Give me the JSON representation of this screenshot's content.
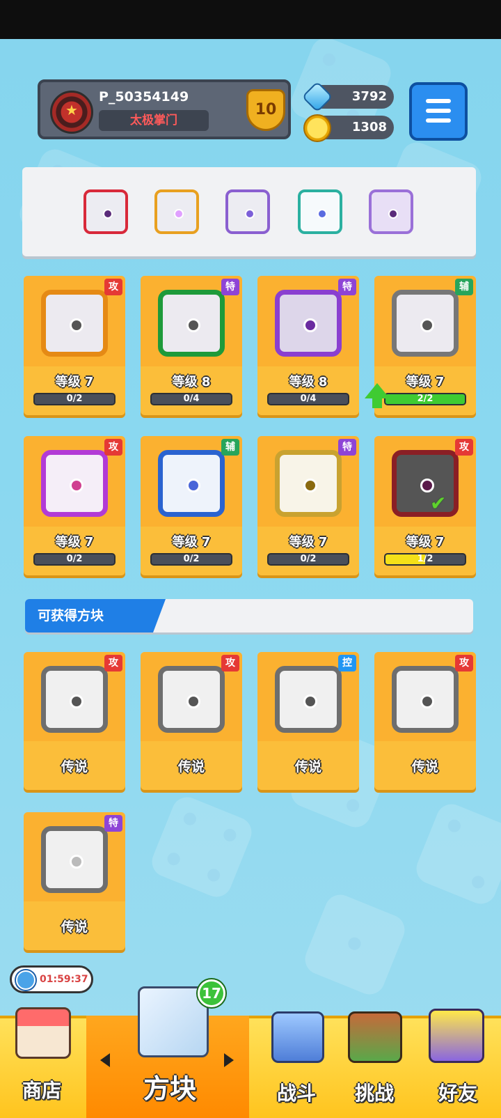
{
  "profile": {
    "name": "P_50354149",
    "title": "太极掌门",
    "rank": "10"
  },
  "currency": {
    "gems": "3792",
    "coins": "1308"
  },
  "equipped": [
    {
      "icon": "vortex-dice-icon",
      "color": "#d8293a"
    },
    {
      "icon": "infinity-dice-icon",
      "color": "#e8a020"
    },
    {
      "icon": "orb-dice-icon",
      "color": "#8a5fd0"
    },
    {
      "icon": "hands-dice-icon",
      "color": "#2bb0a0"
    },
    {
      "icon": "crack-dice-icon",
      "color": "#9a70d8"
    }
  ],
  "owned": [
    {
      "badge": "攻",
      "level": "等级 7",
      "progress": "0/2",
      "ratio": 0,
      "frame_color": "#e58a15",
      "icon": "gun-dice-icon"
    },
    {
      "badge": "特",
      "level": "等级 8",
      "progress": "0/4",
      "ratio": 0,
      "frame_color": "#1e9a3a",
      "icon": "seaweed-dice-icon"
    },
    {
      "badge": "特",
      "level": "等级 8",
      "progress": "0/4",
      "ratio": 0,
      "frame_color": "#8a3fd0",
      "icon": "void-dice-icon"
    },
    {
      "badge": "辅",
      "level": "等级 7",
      "progress": "2/2",
      "ratio": 1,
      "frame_color": "#777777",
      "icon": "cycle-dice-icon",
      "upgradable": true
    },
    {
      "badge": "攻",
      "level": "等级 7",
      "progress": "0/2",
      "ratio": 0,
      "frame_color": "#b23bd6",
      "icon": "combo-dice-icon"
    },
    {
      "badge": "辅",
      "level": "等级 7",
      "progress": "0/2",
      "ratio": 0,
      "frame_color": "#2a63d0",
      "icon": "moon-dice-icon"
    },
    {
      "badge": "特",
      "level": "等级 7",
      "progress": "0/2",
      "ratio": 0,
      "frame_color": "#c9a230",
      "icon": "sun-dice-icon"
    },
    {
      "badge": "攻",
      "level": "等级 7",
      "progress": "1/2",
      "ratio": 0.5,
      "frame_color": "#8a1f25",
      "icon": "blackhole-dice-icon",
      "equipped": true
    }
  ],
  "section": {
    "title": "可获得方块"
  },
  "available": [
    {
      "badge": "攻",
      "label": "传说",
      "icon": "atom-dice-icon"
    },
    {
      "badge": "攻",
      "label": "传说",
      "icon": "swirl-dice-icon"
    },
    {
      "badge": "控",
      "label": "传说",
      "icon": "wave-dice-icon"
    },
    {
      "badge": "攻",
      "label": "传说",
      "icon": "star-dice-icon"
    },
    {
      "badge": "特",
      "label": "传说",
      "icon": "heart-dice-icon"
    }
  ],
  "timer": "01:59:37",
  "nav": {
    "shop": "商店",
    "dice": "方块",
    "battle": "战斗",
    "challenge": "挑战",
    "friends": "好友",
    "dice_badge": "17"
  },
  "colors": {
    "attack": "#e53935",
    "special": "#8e44d6",
    "support": "#27a55b",
    "control": "#2196f3",
    "card_bg": "#fbbe3a"
  }
}
